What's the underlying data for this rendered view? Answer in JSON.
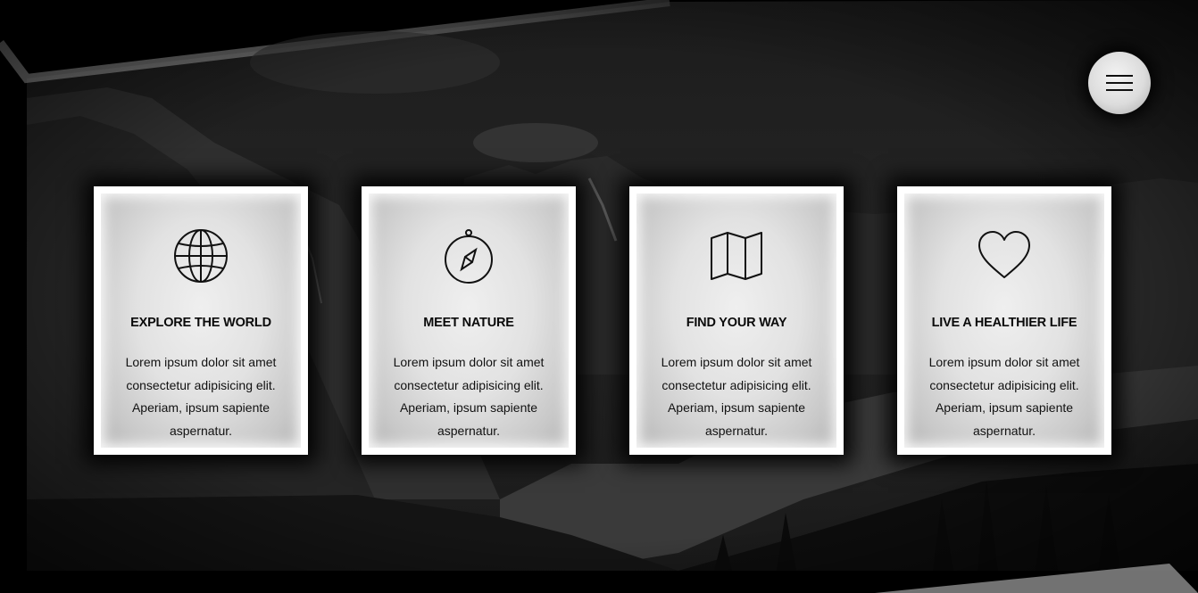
{
  "navigation": {
    "menu_icon": "hamburger-icon"
  },
  "features": [
    {
      "icon": "globe-icon",
      "title": "EXPLORE THE WORLD",
      "text": "Lorem ipsum dolor sit amet consectetur adipisicing elit. Aperiam, ipsum sapiente aspernatur."
    },
    {
      "icon": "compass-icon",
      "title": "MEET NATURE",
      "text": "Lorem ipsum dolor sit amet consectetur adipisicing elit. Aperiam, ipsum sapiente aspernatur."
    },
    {
      "icon": "map-icon",
      "title": "FIND YOUR WAY",
      "text": "Lorem ipsum dolor sit amet consectetur adipisicing elit. Aperiam, ipsum sapiente aspernatur."
    },
    {
      "icon": "heart-icon",
      "title": "LIVE A HEALTHIER LIFE",
      "text": "Lorem ipsum dolor sit amet consectetur adipisicing elit. Aperiam, ipsum sapiente aspernatur."
    }
  ],
  "colors": {
    "card_background": "#ffffff",
    "text": "#0a0a0a",
    "page_background": "#000000"
  }
}
